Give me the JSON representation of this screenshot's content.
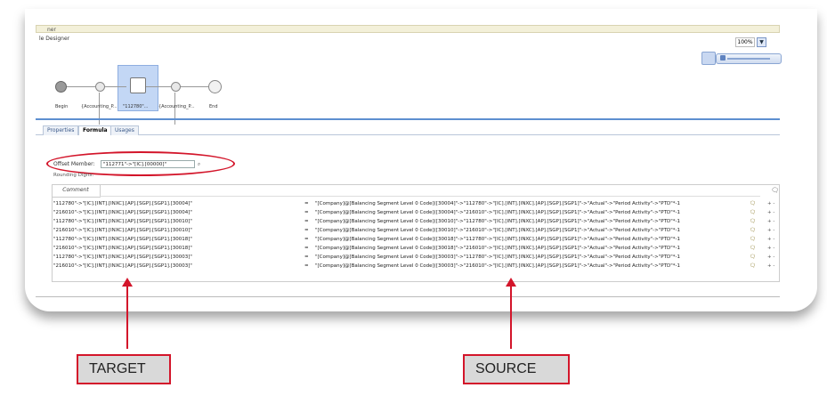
{
  "window": {
    "title_fragment": "ner",
    "subtitle": "le Designer",
    "zoom_value": "100%"
  },
  "flow": {
    "nodes": [
      {
        "label": "Begin"
      },
      {
        "label": "{Accounting_P..."
      },
      {
        "label": "\"112780\"..."
      },
      {
        "label": "{Accounting_P..."
      },
      {
        "label": "End"
      }
    ]
  },
  "tabs": [
    {
      "label": "Properties"
    },
    {
      "label": "Formula"
    },
    {
      "label": "Usages"
    }
  ],
  "form": {
    "offset_label": "Offset Member:",
    "offset_value": "\"112771\"->\"[IC].[00000]\"",
    "rounding_label": "Rounding Digits:"
  },
  "grid": {
    "header": "Comment",
    "rows": [
      {
        "target": "\"112780\"->\"[IC].[INT].[INXC].[AP].[SGP].[SGP1].[30004]\"",
        "op": "=",
        "source": "\"[Company]@[Balancing Segment Level 0 Code]([30004]\"->\"112780\"->\"[IC].[INT].[INXC].[AP].[SGP].[SGP1]\"->\"Actual\"->\"Period Activity\"->\"PTD\"*-1"
      },
      {
        "target": "\"216010\"->\"[IC].[INT].[INXC].[AP].[SGP].[SGP1].[30004]\"",
        "op": "=",
        "source": "\"[Company]@[Balancing Segment Level 0 Code]([30004]\"->\"216010\"->\"[IC].[INT].[INXC].[AP].[SGP].[SGP1]\"->\"Actual\"->\"Period Activity\"->\"PTD\"*-1"
      },
      {
        "target": "\"112780\"->\"[IC].[INT].[INXC].[AP].[SGP].[SGP1].[30010]\"",
        "op": "=",
        "source": "\"[Company]@[Balancing Segment Level 0 Code]([30010]\"->\"112780\"->\"[IC].[INT].[INXC].[AP].[SGP].[SGP1]\"->\"Actual\"->\"Period Activity\"->\"PTD\"*-1"
      },
      {
        "target": "\"216010\"->\"[IC].[INT].[INXC].[AP].[SGP].[SGP1].[30010]\"",
        "op": "=",
        "source": "\"[Company]@[Balancing Segment Level 0 Code]([30010]\"->\"216010\"->\"[IC].[INT].[INXC].[AP].[SGP].[SGP1]\"->\"Actual\"->\"Period Activity\"->\"PTD\"*-1"
      },
      {
        "target": "\"112780\"->\"[IC].[INT].[INXC].[AP].[SGP].[SGP1].[30018]\"",
        "op": "=",
        "source": "\"[Company]@[Balancing Segment Level 0 Code]([30018]\"->\"112780\"->\"[IC].[INT].[INXC].[AP].[SGP].[SGP1]\"->\"Actual\"->\"Period Activity\"->\"PTD\"*-1"
      },
      {
        "target": "\"216010\"->\"[IC].[INT].[INXC].[AP].[SGP].[SGP1].[30018]\"",
        "op": "=",
        "source": "\"[Company]@[Balancing Segment Level 0 Code]([30018]\"->\"216010\"->\"[IC].[INT].[INXC].[AP].[SGP].[SGP1]\"->\"Actual\"->\"Period Activity\"->\"PTD\"*-1"
      },
      {
        "target": "\"112780\"->\"[IC].[INT].[INXC].[AP].[SGP].[SGP1].[30003]\"",
        "op": "=",
        "source": "\"[Company]@[Balancing Segment Level 0 Code]([30003]\"->\"112780\"->\"[IC].[INT].[INXC].[AP].[SGP].[SGP1]\"->\"Actual\"->\"Period Activity\"->\"PTD\"*-1"
      },
      {
        "target": "\"216010\"->\"[IC].[INT].[INXC].[AP].[SGP].[SGP1].[30003]\"",
        "op": "=",
        "source": "\"[Company]@[Balancing Segment Level 0 Code]([30003]\"->\"216010\"->\"[IC].[INT].[INXC].[AP].[SGP].[SGP1]\"->\"Actual\"->\"Period Activity\"->\"PTD\"*-1"
      }
    ],
    "plus_symbol": "+",
    "minus_symbol": "-"
  },
  "callouts": {
    "target": "TARGET",
    "source": "SOURCE"
  },
  "colors": {
    "accent_red": "#d3152a",
    "selected_block": "#c3d7f5"
  }
}
